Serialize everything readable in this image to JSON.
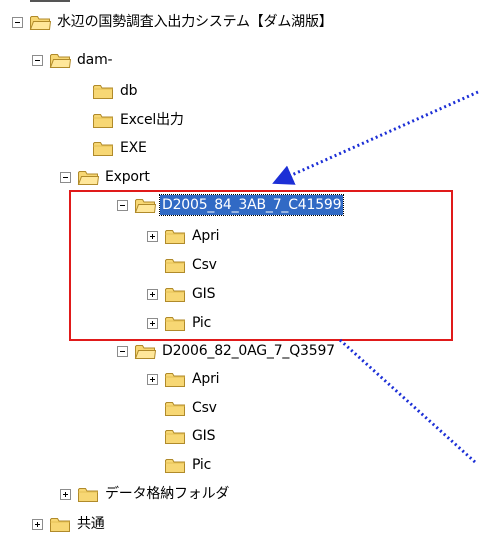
{
  "tree": {
    "nodes": [
      {
        "id": "root",
        "label": "水辺の国勢調査入出力システム【ダム湖版】",
        "expander": "minus"
      },
      {
        "id": "dam",
        "label": "dam-",
        "expander": "minus"
      },
      {
        "id": "db",
        "label": "db",
        "expander": "none"
      },
      {
        "id": "excel",
        "label": "Excel出力",
        "expander": "none"
      },
      {
        "id": "exe",
        "label": "EXE",
        "expander": "none"
      },
      {
        "id": "export",
        "label": "Export",
        "expander": "minus"
      },
      {
        "id": "d2005",
        "label": "D2005_84_3AB_7_C41599",
        "expander": "minus",
        "selected": true
      },
      {
        "id": "d2005-apri",
        "label": "Apri",
        "expander": "plus"
      },
      {
        "id": "d2005-csv",
        "label": "Csv",
        "expander": "none"
      },
      {
        "id": "d2005-gis",
        "label": "GIS",
        "expander": "plus"
      },
      {
        "id": "d2005-pic",
        "label": "Pic",
        "expander": "plus"
      },
      {
        "id": "d2006",
        "label": "D2006_82_0AG_7_Q3597",
        "expander": "minus"
      },
      {
        "id": "d2006-apri",
        "label": "Apri",
        "expander": "plus"
      },
      {
        "id": "d2006-csv",
        "label": "Csv",
        "expander": "none"
      },
      {
        "id": "d2006-gis",
        "label": "GIS",
        "expander": "none"
      },
      {
        "id": "d2006-pic",
        "label": "Pic",
        "expander": "none"
      },
      {
        "id": "data-folder",
        "label": "データ格納フォルダ",
        "expander": "plus"
      },
      {
        "id": "common",
        "label": "共通",
        "expander": "plus"
      }
    ]
  },
  "icons": {
    "folder": "folder-icon",
    "expand": "expand-icon",
    "collapse": "collapse-icon"
  },
  "colors": {
    "selection": "#316ac5",
    "highlight_box": "#e01a1a",
    "arrow": "#1c2fd6",
    "folder_fill": "#f7d774",
    "folder_stroke": "#b08a2a"
  }
}
